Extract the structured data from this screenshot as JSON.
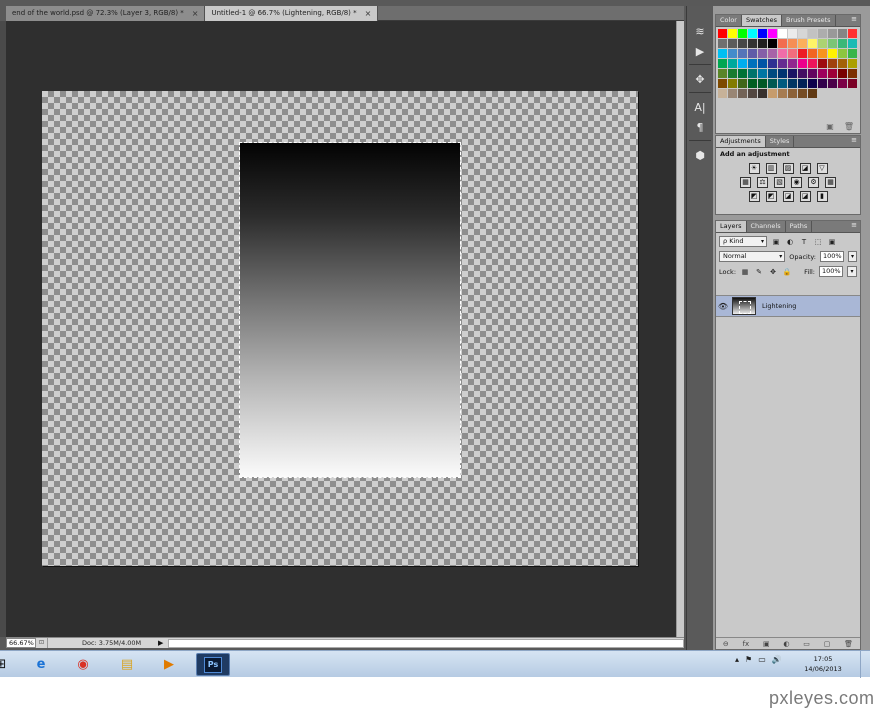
{
  "tabs": [
    {
      "label": "end of the world.psd @ 72.3% (Layer 3, RGB/8) *",
      "close": "×",
      "active": false
    },
    {
      "label": "Untitled-1 @ 66.7% (Lightening, RGB/8) *",
      "close": "×",
      "active": true
    }
  ],
  "status": {
    "zoom": "66.67%",
    "doc": "Doc: 3.75M/4.00M",
    "arrow": "▶"
  },
  "panels": {
    "color_tabs": [
      "Color",
      "Swatches",
      "Brush Presets"
    ],
    "adjustments_tabs": [
      "Adjustments",
      "Styles"
    ],
    "adjustments_title": "Add an adjustment",
    "layers_tabs": [
      "Layers",
      "Channels",
      "Paths"
    ],
    "menu_icon": "≡"
  },
  "swatch_colors": [
    "#ff0000",
    "#ffff00",
    "#00ff00",
    "#00ffff",
    "#0000ff",
    "#ff00ff",
    "#ffffff",
    "#ebebeb",
    "#d6d6d6",
    "#c2c2c2",
    "#adadad",
    "#999999",
    "#858585",
    "#ff3030",
    "#707070",
    "#5c5c5c",
    "#474747",
    "#333333",
    "#1f1f1f",
    "#000000",
    "#f26c4f",
    "#f68e55",
    "#fbaf5c",
    "#fff467",
    "#acd372",
    "#7cc576",
    "#3bb878",
    "#1abbb4",
    "#00bff3",
    "#438ccb",
    "#5574b9",
    "#605ca8",
    "#855fa8",
    "#a763a8",
    "#f06ea9",
    "#f26d7d",
    "#ed1c24",
    "#f26522",
    "#f7941d",
    "#fff200",
    "#8dc63f",
    "#39b54a",
    "#00a651",
    "#00a99d",
    "#00aeef",
    "#0072bc",
    "#0054a6",
    "#2e3192",
    "#662d91",
    "#92278f",
    "#ec008c",
    "#ed145b",
    "#9e0b0f",
    "#a0410d",
    "#a36209",
    "#aba000",
    "#598527",
    "#197b30",
    "#007236",
    "#00746b",
    "#0076a3",
    "#004b80",
    "#003471",
    "#1b1464",
    "#440e62",
    "#630460",
    "#9e005d",
    "#9e0039",
    "#790000",
    "#7b2e00",
    "#7d4900",
    "#827b00",
    "#406618",
    "#005e20",
    "#005826",
    "#005952",
    "#005b7f",
    "#003663",
    "#002157",
    "#0d004c",
    "#32004b",
    "#4b0049",
    "#7b0046",
    "#7a0026",
    "#c7b299",
    "#998675",
    "#736357",
    "#534741",
    "#37302d",
    "#c69c6d",
    "#a67c52",
    "#8c6239",
    "#754c24",
    "#603913"
  ],
  "swatch_footer": [
    "▣",
    "🗑"
  ],
  "adjustment_rows": [
    [
      "☀",
      "▥",
      "▨",
      "◪",
      "▽"
    ],
    [
      "▦",
      "⚖",
      "▧",
      "◉",
      "⚙",
      "▦"
    ],
    [
      "◩",
      "◩",
      "◪",
      "◪",
      "▮"
    ]
  ],
  "layers": {
    "filter_label": "ρ Kind",
    "filter_icons": [
      "▣",
      "◐",
      "T",
      "⬚",
      "▣"
    ],
    "blend_mode": "Normal",
    "opacity_label": "Opacity:",
    "opacity_value": "100%",
    "lock_label": "Lock:",
    "lock_icons": [
      "▦",
      "✎",
      "✥",
      "🔒"
    ],
    "fill_label": "Fill:",
    "fill_value": "100%",
    "dropdown_arrow": "▾",
    "layer_name": "Lightening",
    "visibility_icon": "👁",
    "footer_icons": [
      "⊖",
      "fx",
      "▣",
      "◐",
      "▭",
      "▢",
      "🗑"
    ]
  },
  "tools": [
    "≋",
    "▶",
    "✥",
    "A|",
    "¶",
    "⬢"
  ],
  "taskbar": {
    "apps": [
      "⊞",
      "e",
      "◉",
      "▤",
      "▶"
    ],
    "ps_label": "Ps",
    "tray_icons": [
      "▴",
      "⚑",
      "▭",
      "🔊"
    ],
    "time": "17:05",
    "date": "14/06/2013"
  },
  "watermark": "pxleyes.com"
}
